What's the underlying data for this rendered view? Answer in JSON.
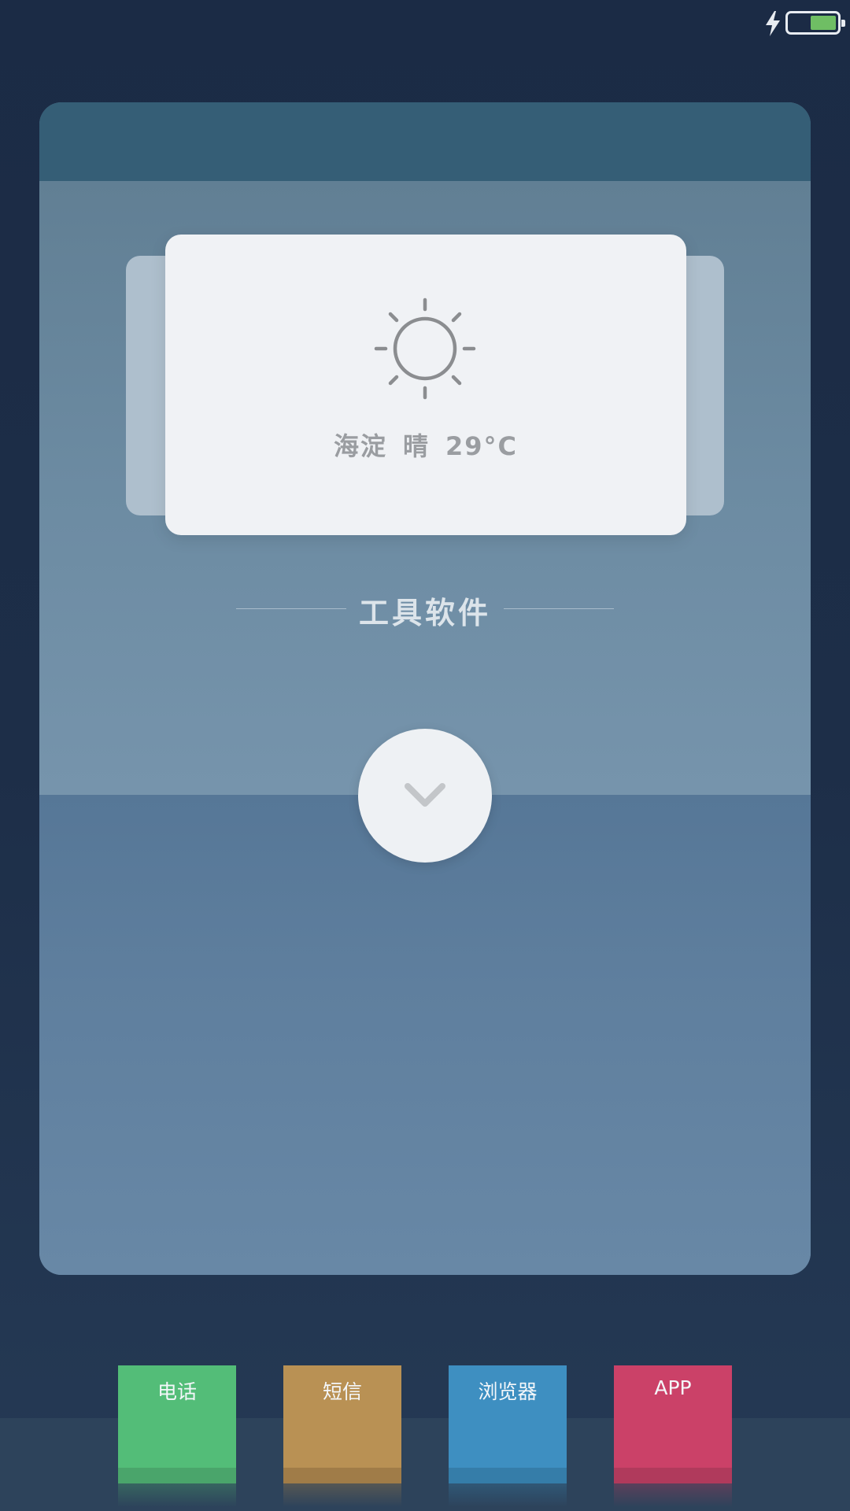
{
  "status_bar": {
    "charging": true,
    "battery_level": 0.55,
    "battery_color": "#6fbe64"
  },
  "weather_card": {
    "icon": "sun-icon",
    "location": "海淀",
    "condition": "晴",
    "temperature": "29°C"
  },
  "section": {
    "title": "工具软件"
  },
  "expand_button": {
    "icon": "chevron-down-icon"
  },
  "dock": {
    "apps": [
      {
        "label": "电话",
        "color": "#53bd78",
        "base_color": "#4aa56b"
      },
      {
        "label": "短信",
        "color": "#b99154",
        "base_color": "#a07c48"
      },
      {
        "label": "浏览器",
        "color": "#3e8fc1",
        "base_color": "#357da9"
      },
      {
        "label": "APP",
        "color": "#cb4168",
        "base_color": "#b03a5c"
      }
    ]
  }
}
